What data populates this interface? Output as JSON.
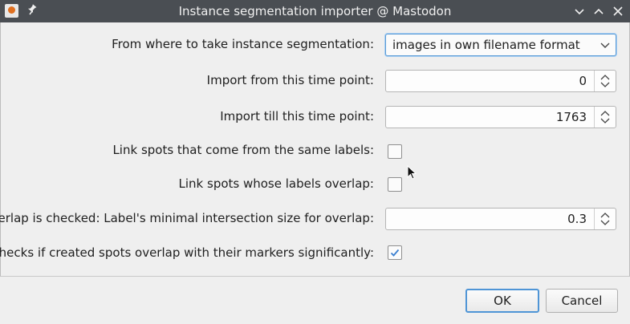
{
  "window": {
    "title": "Instance segmentation importer @ Mastodon"
  },
  "form": {
    "source_label": "From where to take instance segmentation:",
    "source_value": "images in own filename format",
    "from_label": "Import from this time point:",
    "from_value": "0",
    "till_label": "Import till this time point:",
    "till_value": "1763",
    "link_same_label": "Link spots that come from the same labels:",
    "link_same_checked": false,
    "link_overlap_label": "Link spots whose labels overlap:",
    "link_overlap_checked": false,
    "overlap_size_label": "If overlap is checked: Label's minimal intersection size for overlap:",
    "overlap_size_value": "0.3",
    "check_markers_label": "Checks if created spots overlap with their markers significantly:",
    "check_markers_checked": true
  },
  "buttons": {
    "ok": "OK",
    "cancel": "Cancel"
  },
  "colors": {
    "titlebar": "#4a4e53",
    "accent": "#4f95d6",
    "checkmark": "#3a7fd0"
  }
}
